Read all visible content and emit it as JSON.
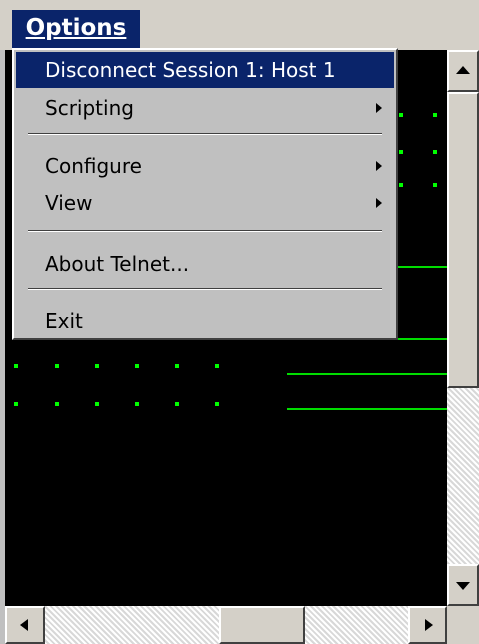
{
  "menubar": {
    "title": "Options"
  },
  "menu": {
    "items": [
      {
        "label": "Disconnect Session 1: Host 1",
        "highlighted": true
      },
      {
        "label": "Scripting",
        "submenu": true
      },
      {
        "label": "Configure",
        "submenu": true
      },
      {
        "label": "View",
        "submenu": true
      },
      {
        "label": "About Telnet..."
      },
      {
        "label": "Exit"
      }
    ]
  },
  "colors": {
    "highlight": "#0a246a",
    "terminal_bg": "#000000",
    "terminal_fg": "#00ff00",
    "menu_bg": "#c0c0c0"
  },
  "icons": {
    "submenu": "chevron-right-icon",
    "scroll_up": "arrow-up-icon",
    "scroll_down": "arrow-down-icon",
    "scroll_left": "arrow-left-icon",
    "scroll_right": "arrow-right-icon"
  }
}
